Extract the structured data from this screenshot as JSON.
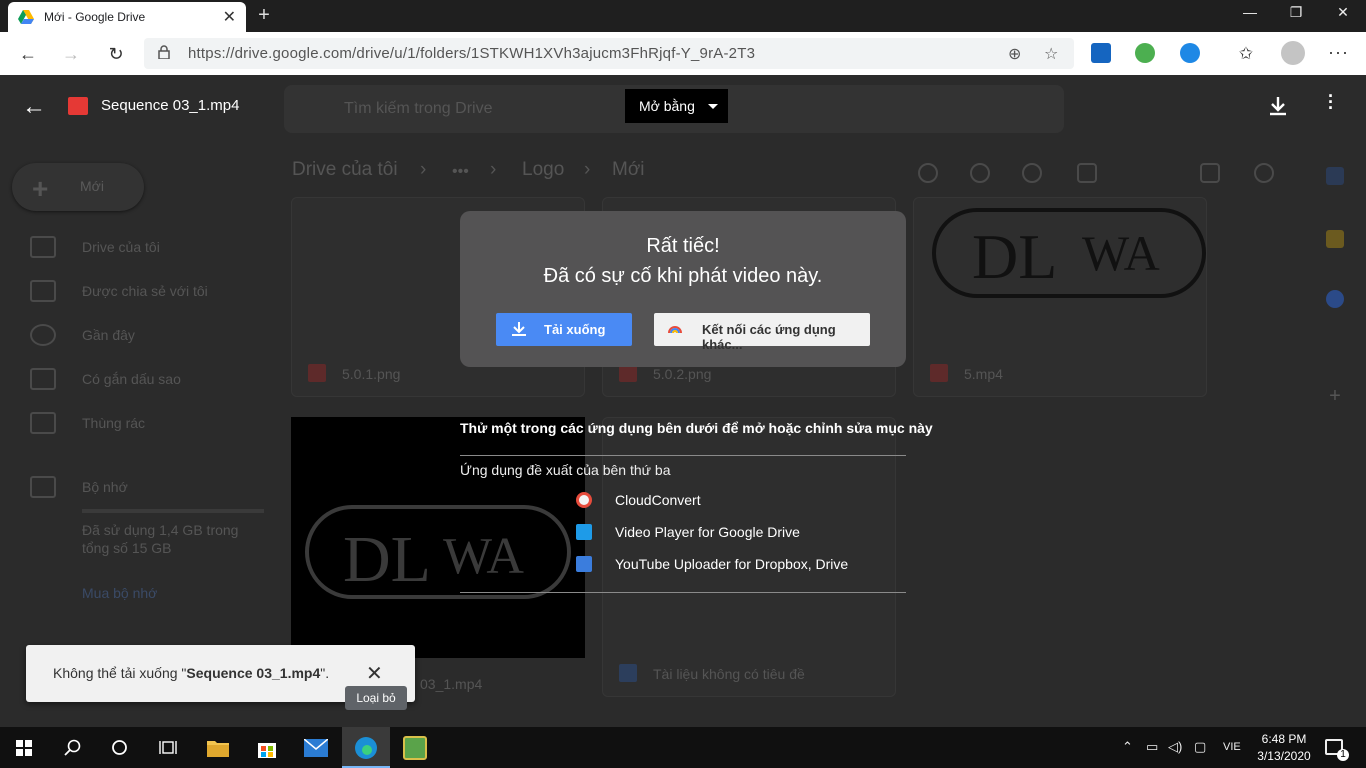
{
  "browser": {
    "tab_title": "Mới - Google Drive",
    "tab_close": "✕",
    "new_tab": "+",
    "minimize": "—",
    "maximize": "❐",
    "close": "✕",
    "url": "https://drive.google.com/drive/u/1/folders/1STKWH1XVh3ajucm3FhRjqf-Y_9rA-2T3",
    "back": "←",
    "forward": "→",
    "reload": "↻",
    "zoom_icon": "⊕",
    "star_icon": "☆",
    "favorites_icon": "✩",
    "more": "···"
  },
  "drive_background": {
    "search_placeholder": "Tìm kiếm trong Drive",
    "new_button": "Mới",
    "sidebar": [
      {
        "label": "Drive của tôi"
      },
      {
        "label": "Được chia sẻ với tôi"
      },
      {
        "label": "Gần đây"
      },
      {
        "label": "Có gắn dấu sao"
      },
      {
        "label": "Thùng rác"
      }
    ],
    "storage_label": "Bộ nhớ",
    "storage_usage": "Đã sử dụng 1,4 GB trong tổng số 15 GB",
    "buy_storage": "Mua bộ nhớ",
    "breadcrumb": [
      "Drive của tôi",
      "•••",
      "Logo",
      "Mới"
    ],
    "files": [
      {
        "name": "5.0.1.png"
      },
      {
        "name": "5.0.2.png"
      },
      {
        "name": "5.mp4"
      },
      {
        "name": "03_1.mp4"
      },
      {
        "name": "Tài liệu không có tiêu đề"
      }
    ]
  },
  "viewer": {
    "back_icon": "←",
    "file_name": "Sequence 03_1.mp4",
    "open_with": "Mở bằng",
    "error_title": "Rất tiếc!",
    "error_message": "Đã có sự cố khi phát video này.",
    "download_button": "Tải xuống",
    "connect_button": "Kết nối các ứng dụng khác...",
    "try_apps_text": "Thử một trong các ứng dụng bên dưới để mở hoặc chỉnh sửa mục này",
    "suggested_header": "Ứng dụng đề xuất của bên thứ ba",
    "apps": [
      {
        "name": "CloudConvert",
        "color": "#e74c3c"
      },
      {
        "name": "Video Player for Google Drive",
        "color": "#1e9be8"
      },
      {
        "name": "YouTube Uploader for Dropbox, Drive",
        "color": "#3b7ddd"
      }
    ]
  },
  "snackbar": {
    "message_prefix": "Không thể tải xuống \"",
    "file_name": "Sequence 03_1.mp4",
    "message_suffix": "\".",
    "close_icon": "✕",
    "tooltip": "Loại bỏ"
  },
  "taskbar": {
    "language": "VIE",
    "time": "6:48 PM",
    "date": "3/13/2020",
    "notifications": "1"
  },
  "colors": {
    "accent_blue": "#4a8af4",
    "dialog_bg": "#545354",
    "video_red": "#e53935"
  }
}
